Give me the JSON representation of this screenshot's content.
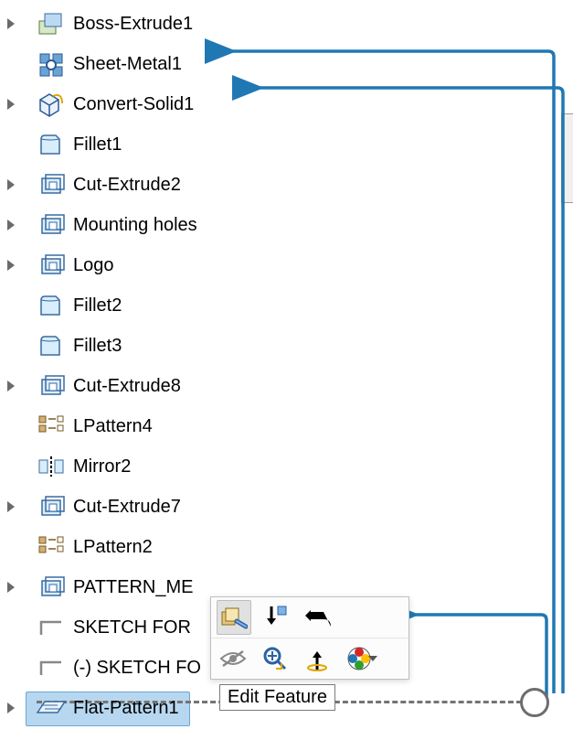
{
  "tree": [
    {
      "label": "Boss-Extrude1",
      "expandable": true,
      "icon": "boss-extrude"
    },
    {
      "label": "Sheet-Metal1",
      "expandable": false,
      "icon": "sheet-metal",
      "callout": true
    },
    {
      "label": "Convert-Solid1",
      "expandable": true,
      "icon": "convert-solid",
      "callout": true
    },
    {
      "label": "Fillet1",
      "expandable": false,
      "icon": "fillet"
    },
    {
      "label": "Cut-Extrude2",
      "expandable": true,
      "icon": "cut-extrude"
    },
    {
      "label": "Mounting holes",
      "expandable": true,
      "icon": "cut-extrude"
    },
    {
      "label": "Logo",
      "expandable": true,
      "icon": "cut-extrude"
    },
    {
      "label": "Fillet2",
      "expandable": false,
      "icon": "fillet"
    },
    {
      "label": "Fillet3",
      "expandable": false,
      "icon": "fillet"
    },
    {
      "label": "Cut-Extrude8",
      "expandable": true,
      "icon": "cut-extrude"
    },
    {
      "label": "LPattern4",
      "expandable": false,
      "icon": "linear-pattern"
    },
    {
      "label": "Mirror2",
      "expandable": false,
      "icon": "mirror"
    },
    {
      "label": "Cut-Extrude7",
      "expandable": true,
      "icon": "cut-extrude"
    },
    {
      "label": "LPattern2",
      "expandable": false,
      "icon": "linear-pattern"
    },
    {
      "label": "PATTERN_ME",
      "expandable": true,
      "icon": "cut-extrude"
    },
    {
      "label": "SKETCH FOR",
      "expandable": false,
      "icon": "sketch",
      "callout": true
    },
    {
      "label": "(-) SKETCH FO",
      "expandable": false,
      "icon": "sketch"
    },
    {
      "label": "Flat-Pattern1",
      "expandable": true,
      "icon": "flat-pattern",
      "selected": true
    }
  ],
  "context_toolbar": {
    "row1": [
      "edit-feature",
      "suppress",
      "rollback"
    ],
    "row2": [
      "hide",
      "zoom-to",
      "normal-to",
      "appearance"
    ]
  },
  "tooltip": "Edit Feature",
  "colors": {
    "callout": "#1f78b4",
    "selection": "#b7d7f0"
  }
}
